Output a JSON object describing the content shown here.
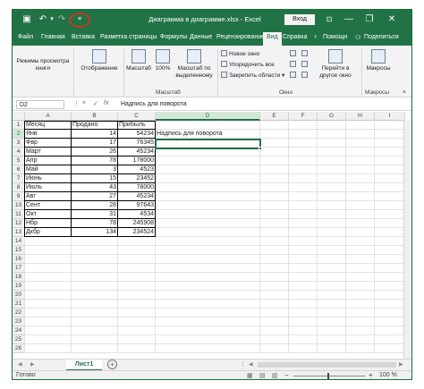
{
  "titlebar": {
    "save_icon": "save-icon",
    "undo_icon": "undo-icon",
    "redo_icon": "redo-icon",
    "qat_customize_icon": "customize-qat-icon",
    "title": "Диаграмма в диаграмме.xlsx  -  Excel",
    "login_label": "Вход",
    "ribbon_options_icon": "ribbon-options-icon",
    "minimize_glyph": "—",
    "restore_glyph": "❐",
    "close_glyph": "✕"
  },
  "tabs": [
    {
      "label": "Файл"
    },
    {
      "label": "Главная"
    },
    {
      "label": "Вставка"
    },
    {
      "label": "Разметка страницы"
    },
    {
      "label": "Формулы"
    },
    {
      "label": "Данные"
    },
    {
      "label": "Рецензирование"
    },
    {
      "label": "Вид"
    },
    {
      "label": "Справка"
    },
    {
      "label": "Помощн"
    },
    {
      "label": "Поделиться"
    }
  ],
  "ribbon": {
    "view_modes": "Режимы просмотра книги",
    "display": "Отображение",
    "zoom": "Масштаб",
    "zoom100": "100%",
    "zoom_selection": "Масштаб по выделенному",
    "zoom_group": "Масштаб",
    "new_window": "Новое окно",
    "arrange_all": "Упорядочить все",
    "freeze_panes": "Закрепить области",
    "window_group": "Окно",
    "switch_windows": "Перейти в другое окно",
    "macros": "Макросы",
    "macros_group": "Макросы"
  },
  "formula_bar": {
    "name_box": "D2",
    "cancel": "×",
    "enter": "✓",
    "fx": "fx",
    "value": "Надпись для поворота"
  },
  "grid": {
    "columns": [
      "A",
      "B",
      "C",
      "D",
      "E",
      "F",
      "G",
      "H",
      "I"
    ],
    "rows": [
      "1",
      "2",
      "3",
      "4",
      "5",
      "6",
      "7",
      "8",
      "9",
      "10",
      "11",
      "12",
      "13",
      "14",
      "15",
      "16",
      "17",
      "18",
      "19",
      "20",
      "21",
      "22",
      "23",
      "24",
      "25",
      "26"
    ],
    "headers": [
      "Месяц",
      "Продано",
      "Прибыль"
    ],
    "data": [
      {
        "month": "Янв",
        "sold": "14",
        "profit": "54234"
      },
      {
        "month": "Фвр",
        "sold": "17",
        "profit": "76345"
      },
      {
        "month": "Март",
        "sold": "26",
        "profit": "45234"
      },
      {
        "month": "Апр",
        "sold": "78",
        "profit": "178000"
      },
      {
        "month": "Май",
        "sold": "3",
        "profit": "4523"
      },
      {
        "month": "Июнь",
        "sold": "15",
        "profit": "23452"
      },
      {
        "month": "Июль",
        "sold": "43",
        "profit": "78000"
      },
      {
        "month": "Авг",
        "sold": "27",
        "profit": "45234"
      },
      {
        "month": "Сент",
        "sold": "28",
        "profit": "97643"
      },
      {
        "month": "Окт",
        "sold": "31",
        "profit": "4534"
      },
      {
        "month": "Нбр",
        "sold": "78",
        "profit": "245908"
      },
      {
        "month": "Дкбр",
        "sold": "134",
        "profit": "234524"
      }
    ],
    "d2": "Надпись для поворота"
  },
  "sheetbar": {
    "prev_glyph": "◀",
    "next_glyph": "▶",
    "sheet_name": "Лист1",
    "add_glyph": "+"
  },
  "statusbar": {
    "ready": "Готово",
    "zoom_minus": "−",
    "zoom_plus": "+",
    "zoom_level": "100 %"
  },
  "colors": {
    "accent": "#217346",
    "annotation": "#c0392b"
  }
}
